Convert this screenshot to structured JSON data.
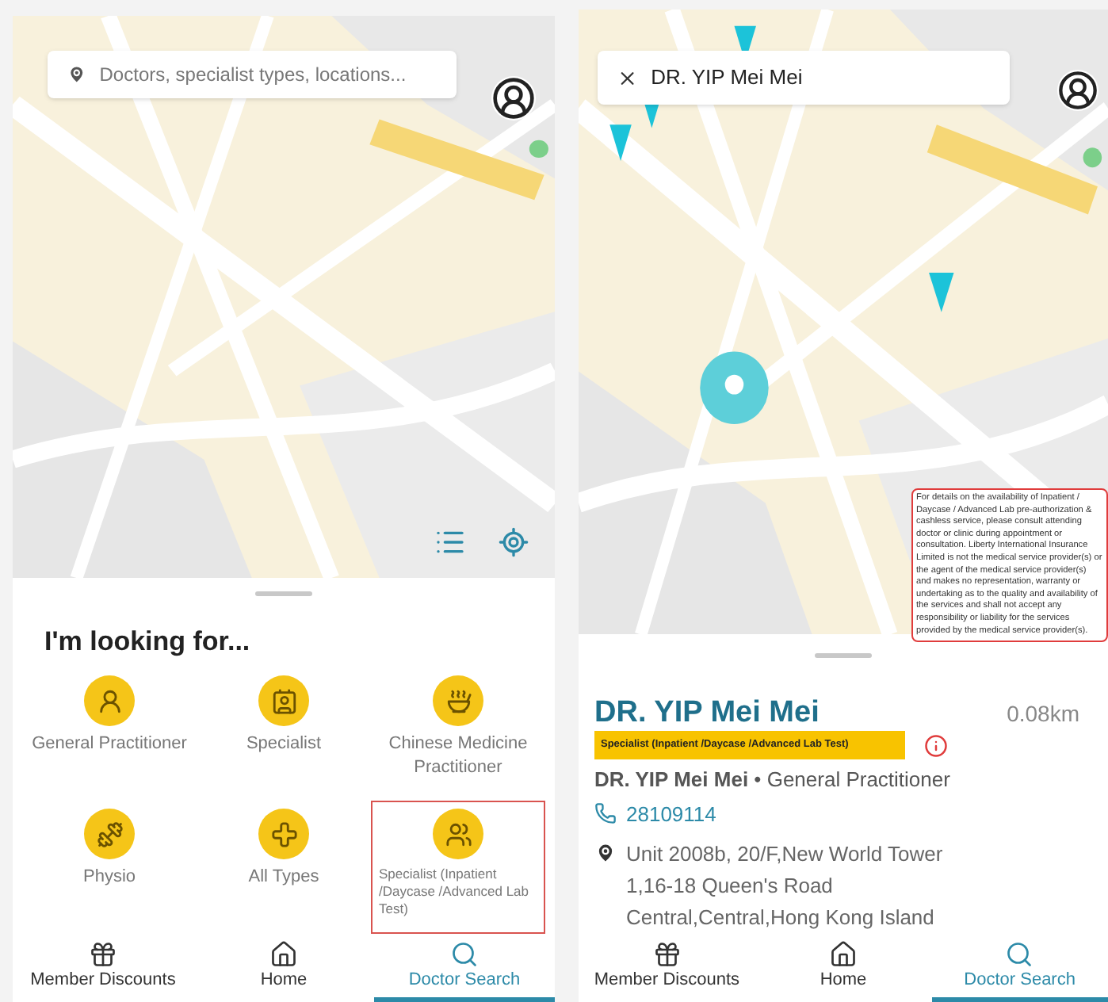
{
  "left_screen": {
    "search": {
      "placeholder": "Doctors, specialist types, locations..."
    },
    "sheet": {
      "title": "I'm looking for...",
      "categories": [
        {
          "label": "General Practitioner",
          "kind": "gp",
          "highlighted": false
        },
        {
          "label": "Specialist",
          "kind": "specialist",
          "highlighted": false
        },
        {
          "label": "Chinese Medicine Practitioner",
          "kind": "chinese",
          "highlighted": false
        },
        {
          "label": "Physio",
          "kind": "physio",
          "highlighted": false
        },
        {
          "label": "All Types",
          "kind": "all",
          "highlighted": false
        },
        {
          "label": "Specialist (Inpatient /Daycase /Advanced Lab Test)",
          "kind": "group",
          "highlighted": true
        }
      ]
    },
    "nav": [
      {
        "label": "Member Discounts",
        "kind": "gift",
        "selected": false
      },
      {
        "label": "Home",
        "kind": "home",
        "selected": false
      },
      {
        "label": "Doctor Search",
        "kind": "search",
        "selected": true
      }
    ]
  },
  "right_screen": {
    "search": {
      "value": "DR. YIP Mei Mei"
    },
    "tooltip": "For details on the availability of Inpatient / Daycase / Advanced Lab pre-authorization & cashless service, please consult attending doctor or clinic during appointment or consultation. Liberty International Insurance Limited is not the medical service provider(s) or the agent of the medical service provider(s) and makes no representation, warranty or undertaking as to the quality and availability of the services and shall not accept any responsibility or liability for the services provided by the medical service provider(s).",
    "doctor": {
      "name": "DR. YIP Mei Mei",
      "distance": "0.08km",
      "badge": "Specialist (Inpatient /Daycase /Advanced Lab Test)",
      "summary": "**DR. YIP Mei Mei** • General Practitioner",
      "phone": "28109114",
      "address": "Unit 2008b, 20/F,New World Tower 1,16-18 Queen's Road Central,Central,Hong Kong Island"
    },
    "nav": [
      {
        "label": "Member Discounts",
        "kind": "gift",
        "selected": false
      },
      {
        "label": "Home",
        "kind": "home",
        "selected": false
      },
      {
        "label": "Doctor Search",
        "kind": "search",
        "selected": true
      }
    ]
  }
}
